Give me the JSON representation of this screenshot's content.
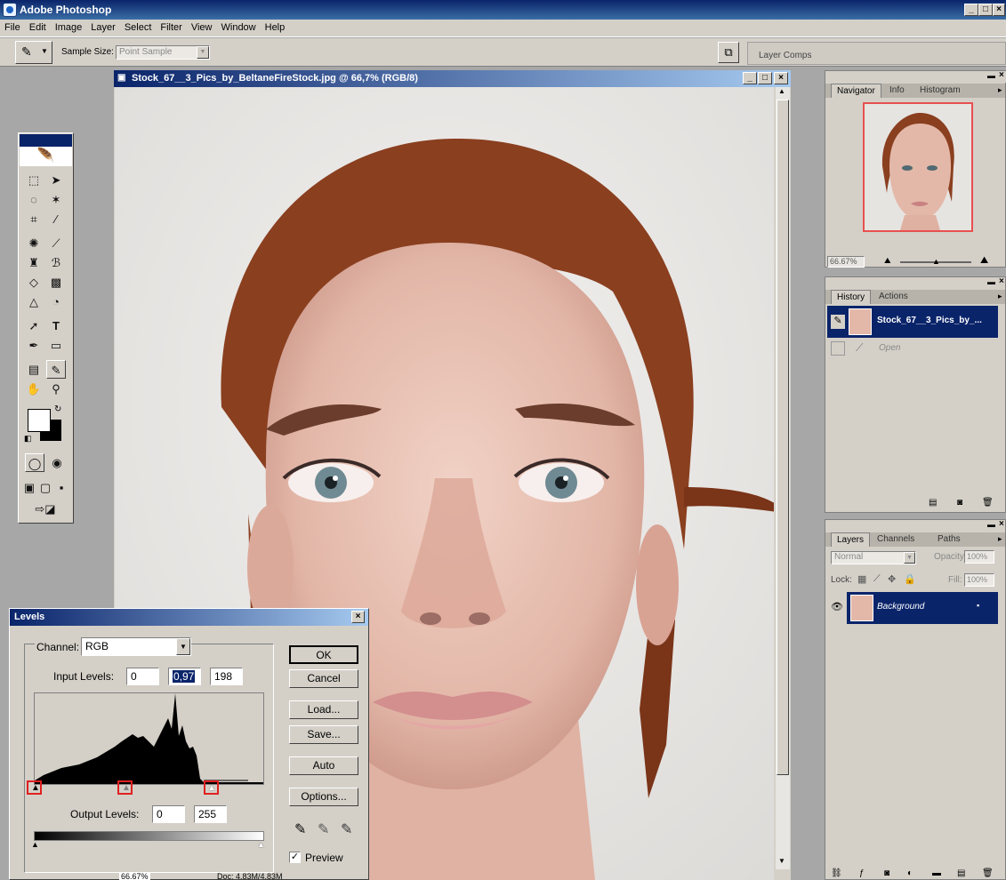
{
  "app": {
    "title": "Adobe Photoshop"
  },
  "menu": [
    "File",
    "Edit",
    "Image",
    "Layer",
    "Select",
    "Filter",
    "View",
    "Window",
    "Help"
  ],
  "options": {
    "sample_size_label": "Sample Size:",
    "sample_size_value": "Point Sample",
    "layer_comps": "Layer Comps"
  },
  "document": {
    "title": "Stock_67__3_Pics_by_BeltaneFireStock.jpg @ 66,7% (RGB/8)"
  },
  "navigator": {
    "tabs": [
      "Navigator",
      "Info",
      "Histogram"
    ],
    "zoom": "66.67%"
  },
  "history": {
    "tabs": [
      "History",
      "Actions"
    ],
    "items": [
      "Stock_67__3_Pics_by_...",
      "Open"
    ]
  },
  "layers": {
    "tabs": [
      "Layers",
      "Channels",
      "Paths"
    ],
    "blend_mode": "Normal",
    "opacity_label": "Opacity:",
    "opacity_value": "100%",
    "lock_label": "Lock:",
    "fill_label": "Fill:",
    "fill_value": "100%",
    "items": [
      "Background"
    ]
  },
  "levels": {
    "title": "Levels",
    "channel_label": "Channel:",
    "channel_value": "RGB",
    "input_label": "Input Levels:",
    "input_black": "0",
    "input_gamma": "0,97",
    "input_white": "198",
    "output_label": "Output Levels:",
    "output_black": "0",
    "output_white": "255",
    "buttons": {
      "ok": "OK",
      "cancel": "Cancel",
      "load": "Load...",
      "save": "Save...",
      "auto": "Auto",
      "options": "Options..."
    },
    "preview_label": "Preview",
    "preview_checked": true
  },
  "status": {
    "zoom": "66.67%",
    "doc": "Doc: 4.83M/4.83M"
  }
}
